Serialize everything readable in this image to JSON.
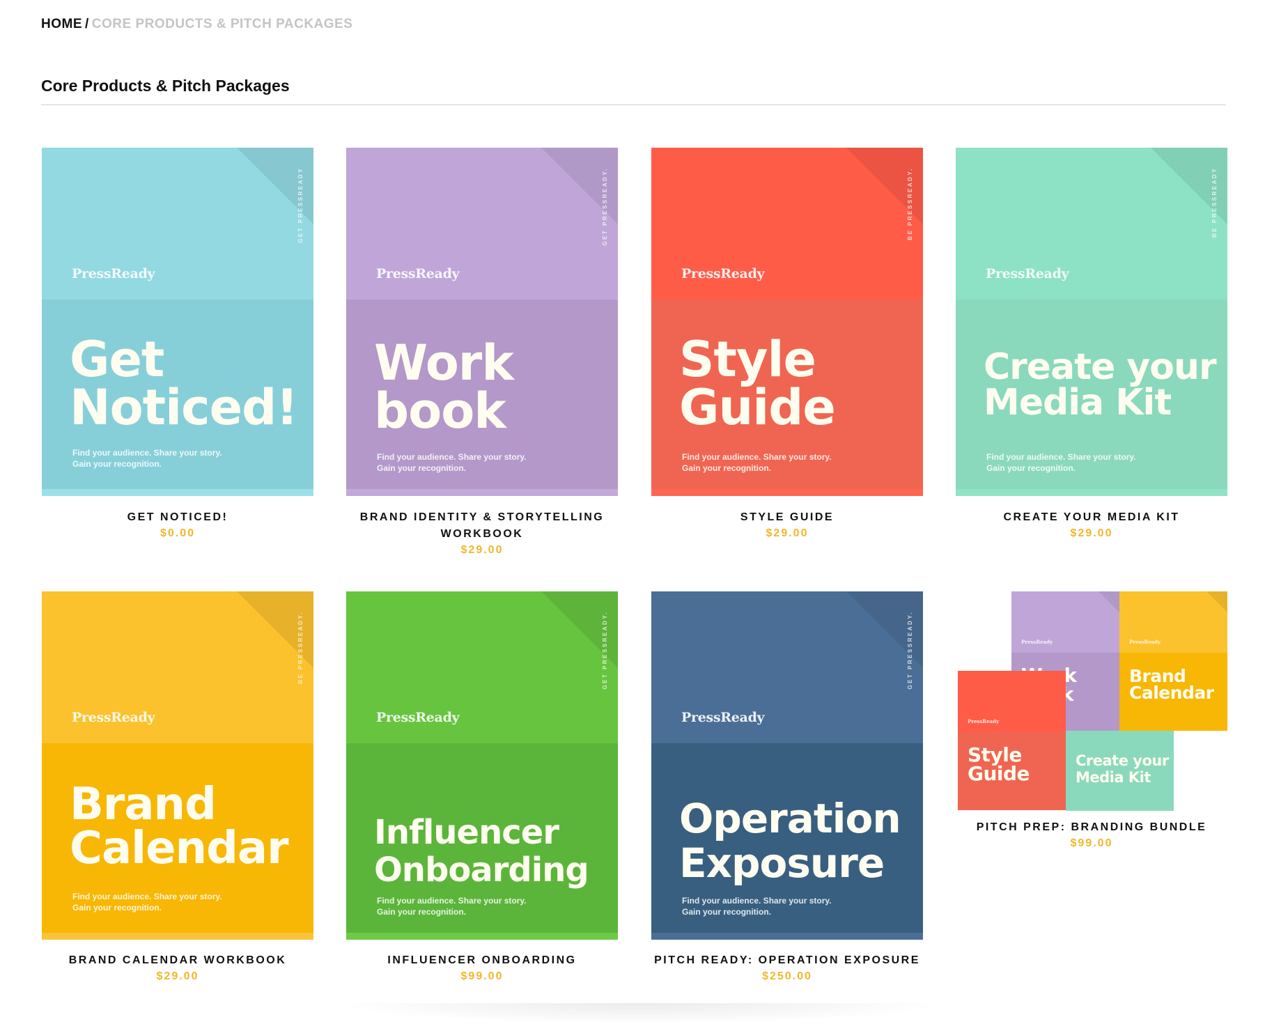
{
  "breadcrumb": {
    "home": "HOME",
    "separator": "/",
    "current": "CORE PRODUCTS & PITCH PACKAGES"
  },
  "page_title": "Core Products & Pitch Packages",
  "cover_common": {
    "brand": "PressReady",
    "tagline_line1": "Find your audience. Share your story.",
    "tagline_line2": "Gain your recognition."
  },
  "products": [
    {
      "name": "GET NOTICED!",
      "price": "$0.00",
      "spine": "GET PRESSREADY",
      "cover_title_1": "Get",
      "cover_title_2": "Noticed!",
      "colors": {
        "top": "#93d9e2",
        "bottom": "#86cfd9",
        "foot": "#9be0e8"
      }
    },
    {
      "name_line1": "BRAND IDENTITY & STORYTELLING",
      "name_line2": "WORKBOOK",
      "price": "$29.00",
      "spine": "GET PRESSREADY.",
      "cover_title_1": "Work",
      "cover_title_2": "book",
      "colors": {
        "top": "#c0a6d8",
        "bottom": "#b398c9",
        "foot": "#c3a9da"
      }
    },
    {
      "name": "STYLE GUIDE",
      "price": "$29.00",
      "spine": "BE PRESSREADY.",
      "cover_title_1": "Style",
      "cover_title_2": "Guide",
      "colors": {
        "top": "#ff5c48",
        "bottom": "#f06551",
        "foot": "#ff6550"
      }
    },
    {
      "name": "CREATE YOUR MEDIA KIT",
      "price": "$29.00",
      "spine": "BE PRESSREADY",
      "cover_title_1": "Create your",
      "cover_title_2": "Media Kit",
      "colors": {
        "top": "#8de2c5",
        "bottom": "#8ad9bc",
        "foot": "#90e3c7"
      }
    },
    {
      "name": "BRAND CALENDAR WORKBOOK",
      "price": "$29.00",
      "spine": "BE PRESSREADY.",
      "cover_title_1": "Brand",
      "cover_title_2": "Calendar",
      "colors": {
        "top": "#fbc22e",
        "bottom": "#f8b704",
        "foot": "#fac43a"
      }
    },
    {
      "name": "INFLUENCER ONBOARDING",
      "price": "$99.00",
      "spine": "GET PRESSREADY.",
      "cover_title_1": "Influencer",
      "cover_title_2": "Onboarding",
      "colors": {
        "top": "#67c43f",
        "bottom": "#5bb53a",
        "foot": "#6ccb44"
      }
    },
    {
      "name": "PITCH READY: OPERATION EXPOSURE",
      "price": "$250.00",
      "spine": "GET PRESSREADY.",
      "cover_title_1": "Operation",
      "cover_title_2": "Exposure",
      "colors": {
        "top": "#4b6e96",
        "bottom": "#385f80",
        "foot": "#4b6e96"
      }
    },
    {
      "name": "PITCH PREP: BRANDING BUNDLE",
      "price": "$99.00"
    }
  ]
}
